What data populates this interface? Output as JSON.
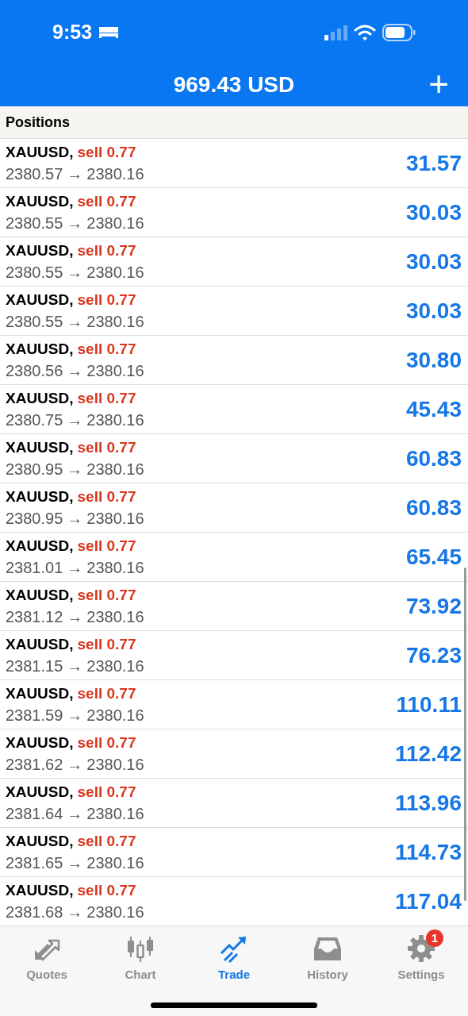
{
  "status_bar": {
    "time": "9:53"
  },
  "header": {
    "balance": "969.43 USD",
    "add_button": "+"
  },
  "section": {
    "title": "Positions"
  },
  "positions": [
    {
      "symbol": "XAUUSD,",
      "side": "sell 0.77",
      "open_price": "2380.57",
      "arrow": "→",
      "current_price": "2380.16",
      "profit": "31.57"
    },
    {
      "symbol": "XAUUSD,",
      "side": "sell 0.77",
      "open_price": "2380.55",
      "arrow": "→",
      "current_price": "2380.16",
      "profit": "30.03"
    },
    {
      "symbol": "XAUUSD,",
      "side": "sell 0.77",
      "open_price": "2380.55",
      "arrow": "→",
      "current_price": "2380.16",
      "profit": "30.03"
    },
    {
      "symbol": "XAUUSD,",
      "side": "sell 0.77",
      "open_price": "2380.55",
      "arrow": "→",
      "current_price": "2380.16",
      "profit": "30.03"
    },
    {
      "symbol": "XAUUSD,",
      "side": "sell 0.77",
      "open_price": "2380.56",
      "arrow": "→",
      "current_price": "2380.16",
      "profit": "30.80"
    },
    {
      "symbol": "XAUUSD,",
      "side": "sell 0.77",
      "open_price": "2380.75",
      "arrow": "→",
      "current_price": "2380.16",
      "profit": "45.43"
    },
    {
      "symbol": "XAUUSD,",
      "side": "sell 0.77",
      "open_price": "2380.95",
      "arrow": "→",
      "current_price": "2380.16",
      "profit": "60.83"
    },
    {
      "symbol": "XAUUSD,",
      "side": "sell 0.77",
      "open_price": "2380.95",
      "arrow": "→",
      "current_price": "2380.16",
      "profit": "60.83"
    },
    {
      "symbol": "XAUUSD,",
      "side": "sell 0.77",
      "open_price": "2381.01",
      "arrow": "→",
      "current_price": "2380.16",
      "profit": "65.45"
    },
    {
      "symbol": "XAUUSD,",
      "side": "sell 0.77",
      "open_price": "2381.12",
      "arrow": "→",
      "current_price": "2380.16",
      "profit": "73.92"
    },
    {
      "symbol": "XAUUSD,",
      "side": "sell 0.77",
      "open_price": "2381.15",
      "arrow": "→",
      "current_price": "2380.16",
      "profit": "76.23"
    },
    {
      "symbol": "XAUUSD,",
      "side": "sell 0.77",
      "open_price": "2381.59",
      "arrow": "→",
      "current_price": "2380.16",
      "profit": "110.11"
    },
    {
      "symbol": "XAUUSD,",
      "side": "sell 0.77",
      "open_price": "2381.62",
      "arrow": "→",
      "current_price": "2380.16",
      "profit": "112.42"
    },
    {
      "symbol": "XAUUSD,",
      "side": "sell 0.77",
      "open_price": "2381.64",
      "arrow": "→",
      "current_price": "2380.16",
      "profit": "113.96"
    },
    {
      "symbol": "XAUUSD,",
      "side": "sell 0.77",
      "open_price": "2381.65",
      "arrow": "→",
      "current_price": "2380.16",
      "profit": "114.73"
    },
    {
      "symbol": "XAUUSD,",
      "side": "sell 0.77",
      "open_price": "2381.68",
      "arrow": "→",
      "current_price": "2380.16",
      "profit": "117.04"
    }
  ],
  "tab_bar": [
    {
      "kind": "quotes",
      "label": "Quotes",
      "selected": false
    },
    {
      "kind": "chart",
      "label": "Chart",
      "selected": false
    },
    {
      "kind": "trade",
      "label": "Trade",
      "selected": true
    },
    {
      "kind": "history",
      "label": "History",
      "selected": false
    },
    {
      "kind": "settings",
      "label": "Settings",
      "selected": false,
      "badge": "1"
    }
  ]
}
